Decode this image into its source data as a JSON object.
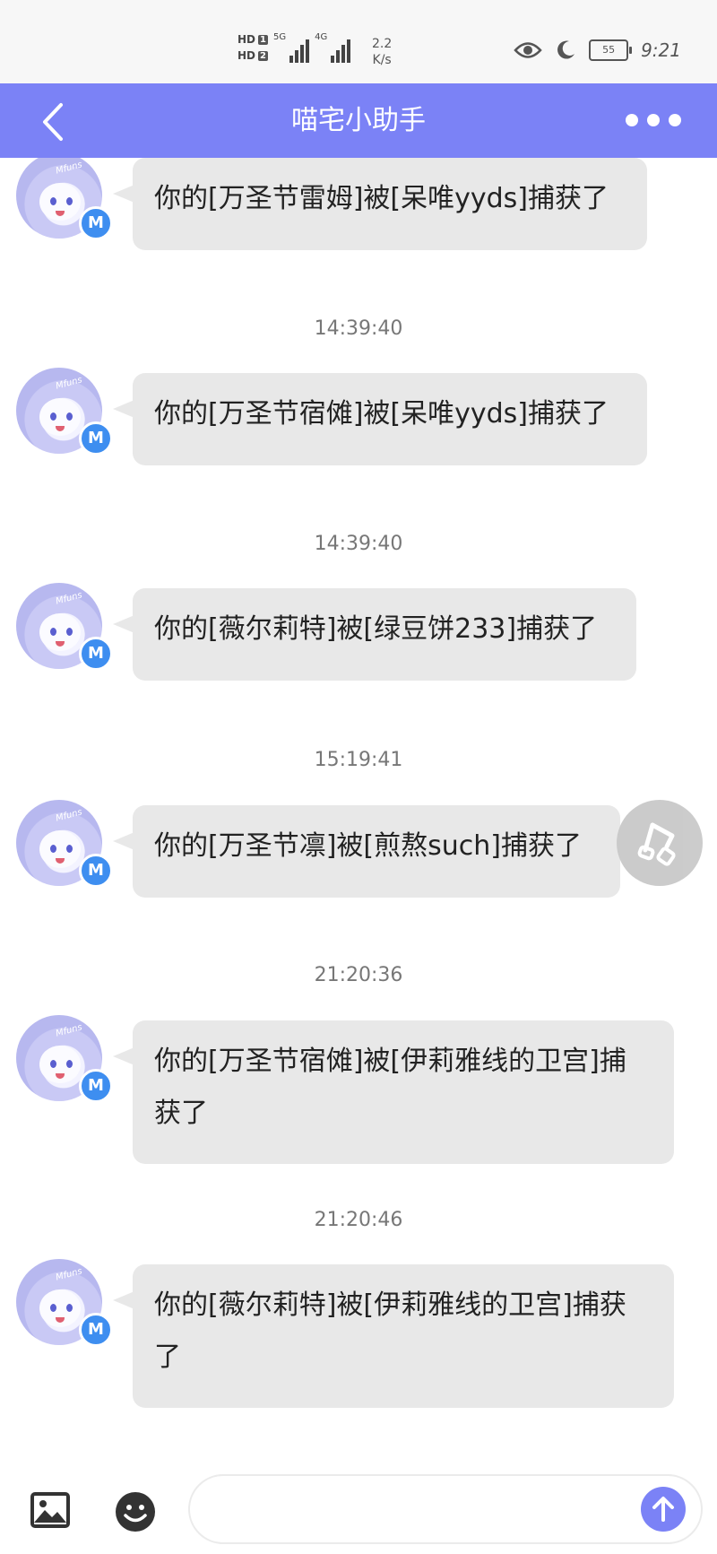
{
  "status_bar": {
    "hd1": "HD",
    "hd1_num": "1",
    "hd2": "HD",
    "hd2_num": "2",
    "net1": "5G",
    "net2": "4G",
    "speed_value": "2.2",
    "speed_unit": "K/s",
    "battery": "55",
    "time": "9:21"
  },
  "header": {
    "title": "喵宅小助手"
  },
  "messages": [
    {
      "time": "",
      "text": "你的[万圣节雷姆]被[呆唯yyds]捕获了"
    },
    {
      "time": "14:39:40",
      "text": "你的[万圣节宿傩]被[呆唯yyds]捕获了"
    },
    {
      "time": "14:39:40",
      "text": "你的[薇尔莉特]被[绿豆饼233]捕获了"
    },
    {
      "time": "15:19:41",
      "text": "你的[万圣节凛]被[煎熬such]捕获了"
    },
    {
      "time": "21:20:36",
      "text": "你的[万圣节宿傩]被[伊莉雅线的卫宫]捕获了"
    },
    {
      "time": "21:20:46",
      "text": "你的[薇尔莉特]被[伊莉雅线的卫宫]捕获了"
    }
  ],
  "avatar": {
    "label": "Mfuns",
    "badge": "M"
  },
  "bottom_bar": {
    "input_value": "",
    "input_placeholder": ""
  },
  "colors": {
    "accent": "#7b82f6",
    "bubble": "#e8e8e8",
    "badge": "#3e8ef0"
  }
}
